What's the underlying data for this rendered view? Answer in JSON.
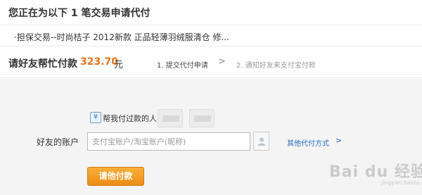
{
  "header": {
    "title": "您正在为以下 1 笔交易申请代付"
  },
  "item": {
    "description": "·担保交易--时尚桔子 2012新款 正品轻薄羽绒服清仓 修..."
  },
  "steps": {
    "heading": "请好友帮忙付款",
    "amount": "323.70",
    "currency": "元",
    "step1": "1. 提交代付申请",
    "arrow": ">",
    "step2": "2. 通知好友来支付宝付款"
  },
  "helped": {
    "icon_glyph": "¥",
    "label": "帮我付过款的人:"
  },
  "account": {
    "label": "好友的账户",
    "placeholder": "支付宝账户/淘宝账户(昵称)",
    "other_link": "其他代付方式",
    "other_arrow": ">"
  },
  "pay_button": {
    "label": "请他付款"
  },
  "watermark": {
    "text": "Bai du 经验",
    "sub": "jingyan.baidu.com"
  },
  "colors": {
    "accent": "#e4741e",
    "link": "#2a6bbd",
    "button": "#ec8c16"
  },
  "icons": [
    "yuan-icon",
    "contact-book-icon"
  ]
}
